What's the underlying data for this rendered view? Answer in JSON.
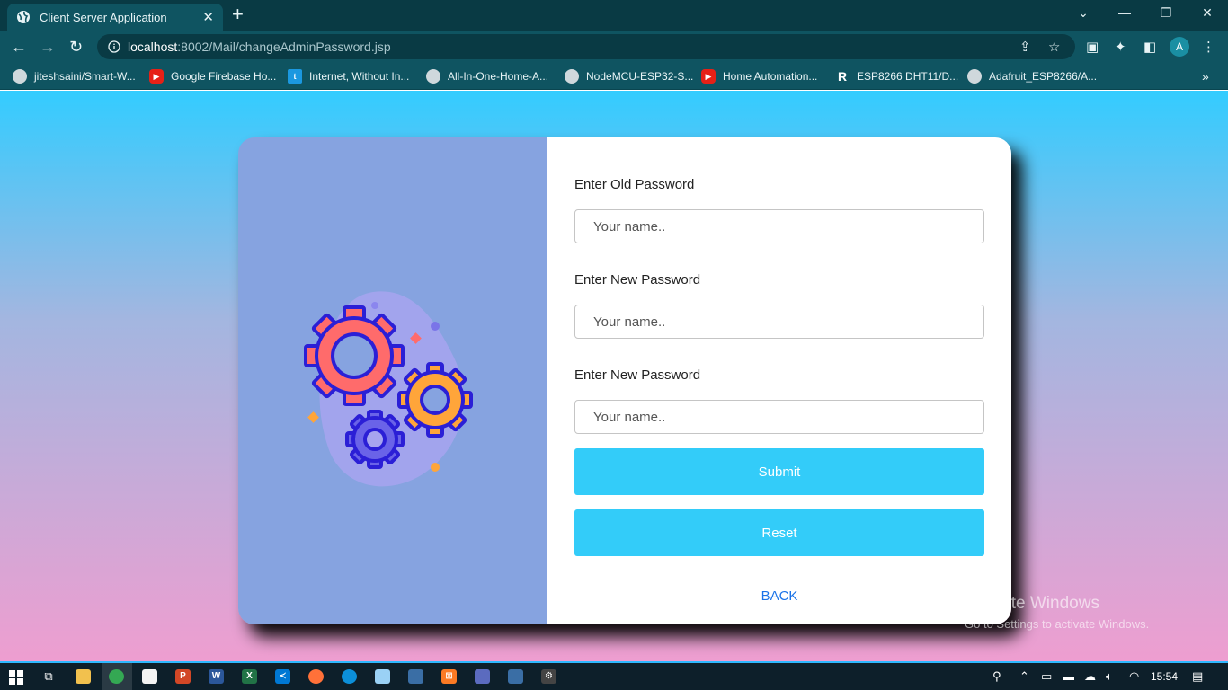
{
  "browser": {
    "tab_title": "Client Server Application",
    "url_host": "localhost",
    "url_rest": ":8002/Mail/changeAdminPassword.jsp",
    "avatar_letter": "A",
    "bookmarks": [
      {
        "label": "jiteshsaini/Smart-W...",
        "icon": "github-icon"
      },
      {
        "label": "Google Firebase Ho...",
        "icon": "youtube-icon"
      },
      {
        "label": "Internet, Without In...",
        "icon": "page-icon"
      },
      {
        "label": "All-In-One-Home-A...",
        "icon": "github-icon"
      },
      {
        "label": "NodeMCU-ESP32-S...",
        "icon": "github-icon"
      },
      {
        "label": "Home Automation...",
        "icon": "youtube-icon"
      },
      {
        "label": "ESP8266 DHT11/D...",
        "icon": "r-icon"
      },
      {
        "label": "Adafruit_ESP8266/A...",
        "icon": "github-icon"
      }
    ]
  },
  "form": {
    "old_password_label": "Enter Old Password",
    "new_password_label": "Enter New Password",
    "confirm_password_label": "Enter New Password",
    "placeholder": "Your name..",
    "submit_label": "Submit",
    "reset_label": "Reset",
    "back_label": "BACK"
  },
  "watermark": {
    "line1": "Activate Windows",
    "line2": "Go to Settings to activate Windows."
  },
  "taskbar": {
    "time": "15:54"
  },
  "colors": {
    "accent": "#33ccf9",
    "card_left": "#86a3e0",
    "gear_large": "#ff6b6b",
    "gear_small": "#ffa53a",
    "gear_outline": "#2b1fd6"
  }
}
